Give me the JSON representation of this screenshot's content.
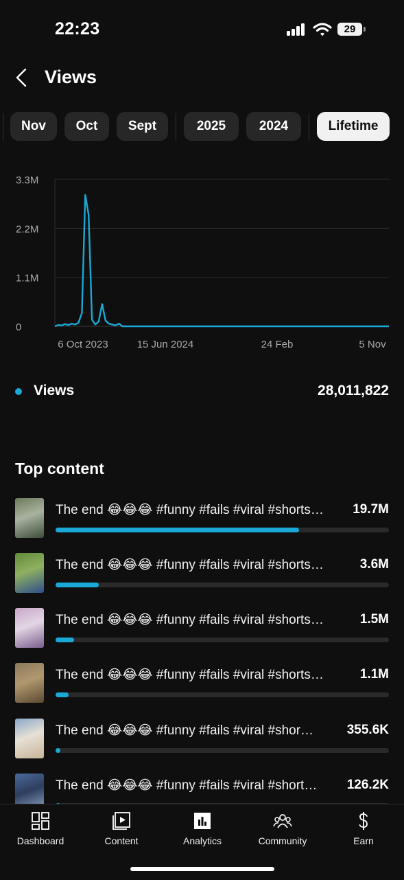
{
  "status": {
    "time": "22:23",
    "battery": "29"
  },
  "header": {
    "title": "Views"
  },
  "periods": {
    "months": [
      "Nov",
      "Oct",
      "Sept"
    ],
    "years": [
      "2025",
      "2024"
    ],
    "lifetime": "Lifetime",
    "selected": "Lifetime"
  },
  "chart_data": {
    "type": "line",
    "ylabel": "",
    "xlabel": "",
    "y_ticks": [
      "3.3M",
      "2.2M",
      "1.1M",
      "0"
    ],
    "x_ticks": [
      "6 Oct 2023",
      "15 Jun 2024",
      "24 Feb",
      "5 Nov"
    ],
    "ylim": [
      0,
      3300000
    ],
    "grid": true,
    "series": [
      {
        "name": "Views",
        "color": "#1aa8d6",
        "values": [
          0,
          30000,
          20000,
          50000,
          30000,
          60000,
          40000,
          80000,
          300000,
          2950000,
          2500000,
          150000,
          40000,
          110000,
          500000,
          130000,
          60000,
          40000,
          20000,
          60000,
          0,
          0,
          0,
          0,
          0,
          0,
          0,
          0,
          0,
          0,
          0,
          0,
          0,
          0,
          0,
          0,
          0,
          0,
          0,
          0,
          0,
          0,
          0,
          0,
          0,
          0,
          0,
          0,
          0,
          0,
          0,
          0,
          0,
          0,
          0,
          0,
          0,
          0,
          0,
          0,
          0,
          0,
          0,
          0,
          0,
          0,
          0,
          0,
          0,
          0,
          0,
          0,
          0,
          0,
          0,
          0,
          0,
          0,
          0,
          0,
          0,
          0,
          0,
          0,
          0,
          0,
          0,
          0,
          0,
          0,
          0,
          0,
          0,
          0,
          0,
          0,
          0,
          0,
          0,
          0
        ]
      }
    ]
  },
  "metric": {
    "label": "Views",
    "value": "28,011,822"
  },
  "top_content": {
    "title": "Top content",
    "items": [
      {
        "title": "The end 😂😂😂 #funny #fails #viral #shorts…",
        "value": "19.7M",
        "share": 0.73,
        "thumb_colors": [
          "#6b7a5a",
          "#3d4e3a",
          "#a9b2a0"
        ]
      },
      {
        "title": "The end 😂😂😂 #funny #fails #viral #shorts…",
        "value": "3.6M",
        "share": 0.13,
        "thumb_colors": [
          "#5f8a3a",
          "#2e4f8a",
          "#8fb060"
        ]
      },
      {
        "title": "The end 😂😂😂 #funny #fails #viral #shorts…",
        "value": "1.5M",
        "share": 0.055,
        "thumb_colors": [
          "#c9a6c8",
          "#7a5f8e",
          "#e2d6e4"
        ]
      },
      {
        "title": "The end 😂😂😂 #funny #fails #viral #shorts…",
        "value": "1.1M",
        "share": 0.04,
        "thumb_colors": [
          "#8a7a5a",
          "#5b4a32",
          "#b09870"
        ]
      },
      {
        "title": "The end 😂😂😂 #funny #fails #viral #shor…",
        "value": "355.6K",
        "share": 0.013,
        "thumb_colors": [
          "#8aa6c8",
          "#c8b49a",
          "#e6e0d6"
        ]
      },
      {
        "title": "The end 😂😂😂 #funny #fails #viral #short…",
        "value": "126.2K",
        "share": 0.005,
        "thumb_colors": [
          "#4a6a9a",
          "#9ab0d0",
          "#2e3e5e"
        ]
      }
    ]
  },
  "nav": [
    {
      "label": "Dashboard",
      "icon": "dashboard-icon"
    },
    {
      "label": "Content",
      "icon": "content-icon"
    },
    {
      "label": "Analytics",
      "icon": "analytics-icon"
    },
    {
      "label": "Community",
      "icon": "community-icon"
    },
    {
      "label": "Earn",
      "icon": "earn-icon"
    }
  ]
}
